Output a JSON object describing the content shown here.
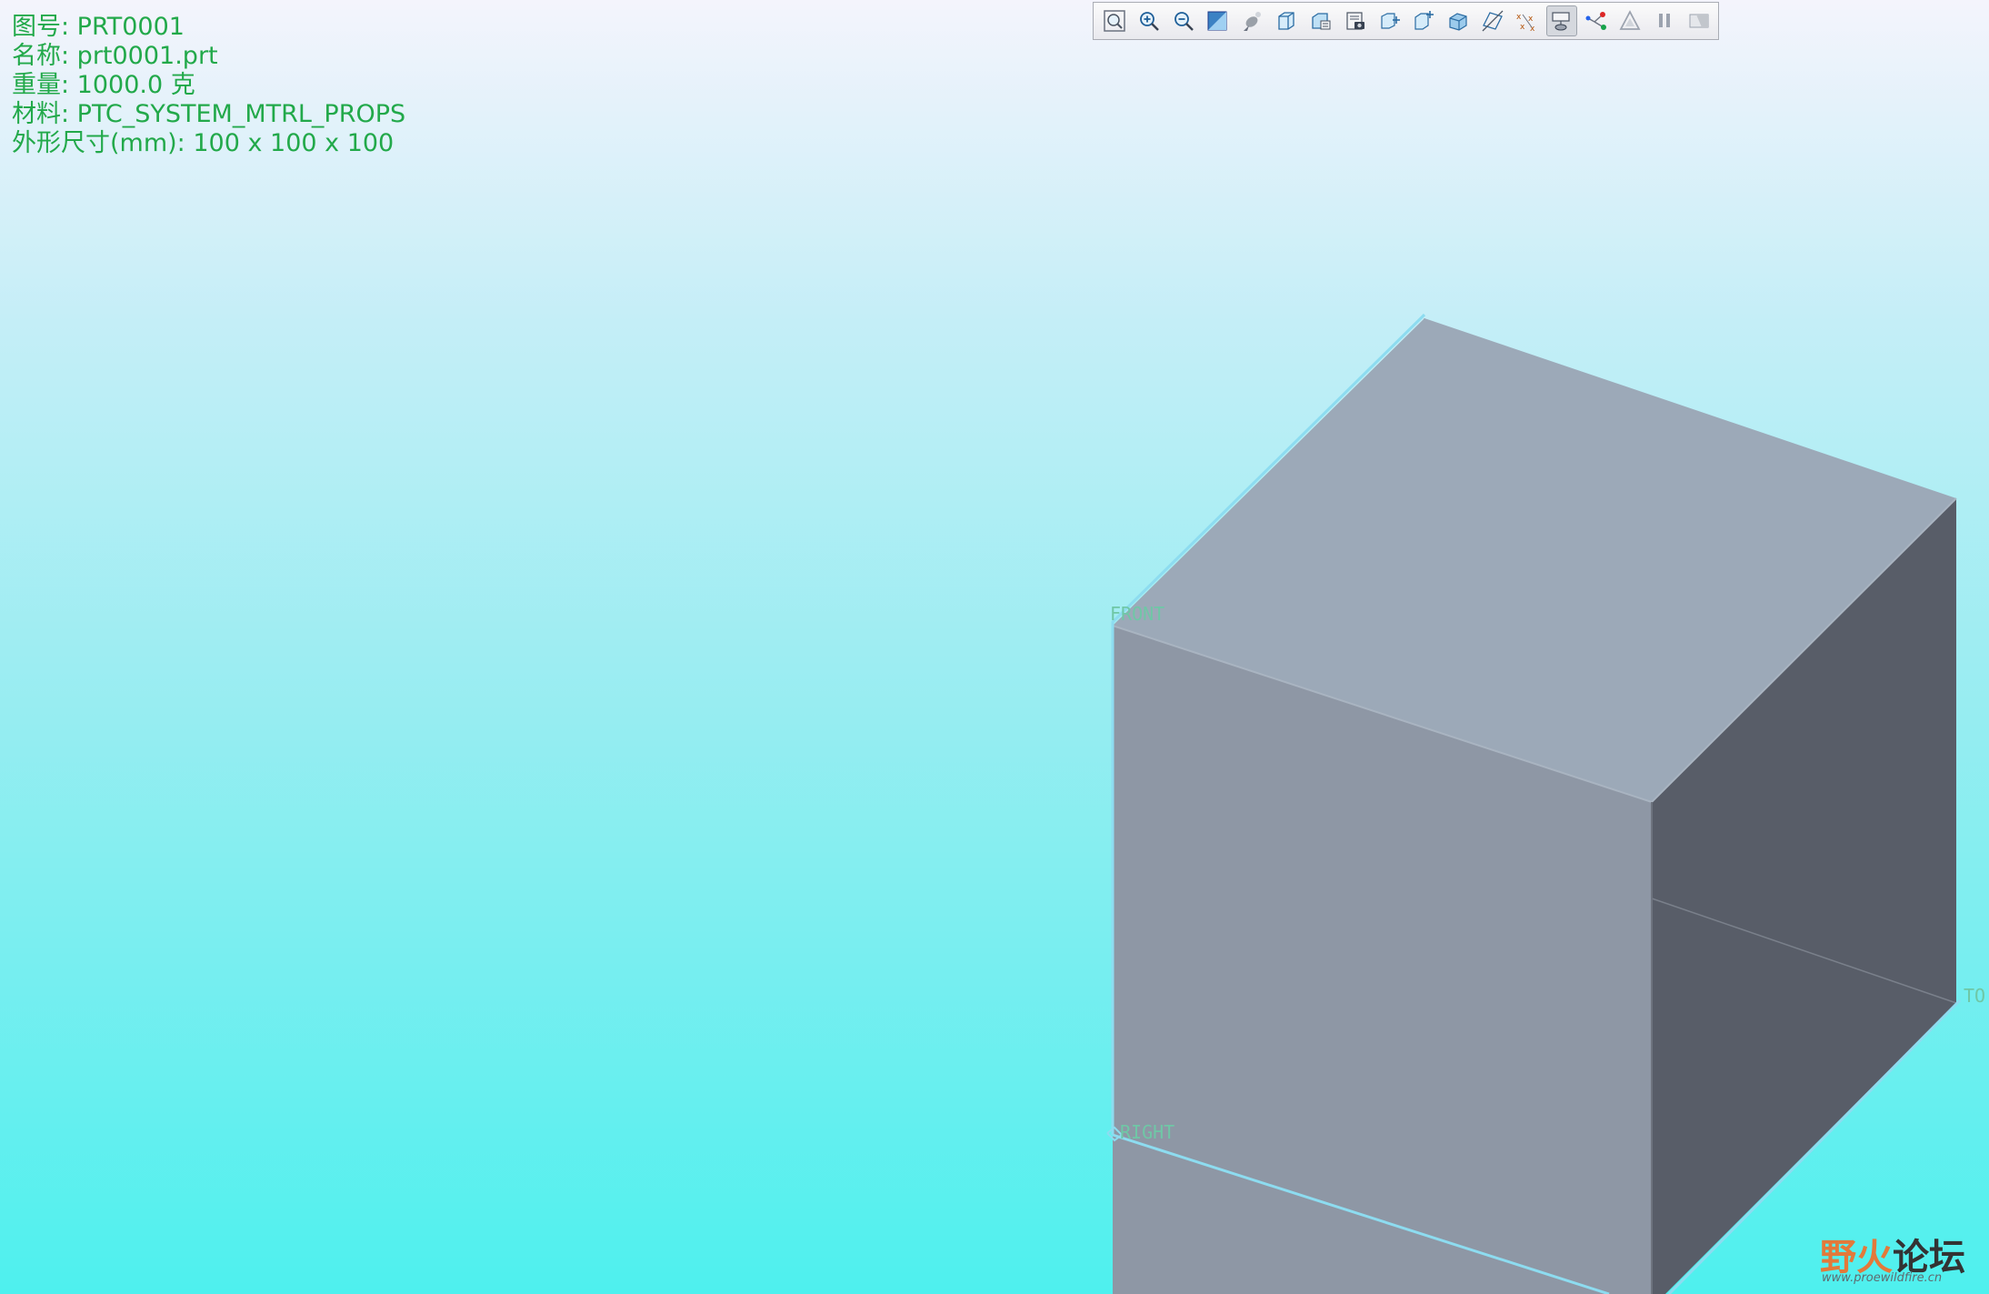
{
  "info": {
    "rows": [
      "图号: PRT0001",
      "名称: prt0001.prt",
      "重量: 1000.0 克",
      "材料: PTC_SYSTEM_MTRL_PROPS",
      "外形尺寸(mm): 100 x 100 x 100"
    ]
  },
  "toolbar": {
    "buttons": [
      {
        "icon": "refit-icon",
        "active": false
      },
      {
        "icon": "zoom-in-icon",
        "active": false
      },
      {
        "icon": "zoom-out-icon",
        "active": false
      },
      {
        "icon": "repaint-icon",
        "active": false
      },
      {
        "icon": "pan-icon",
        "active": false
      },
      {
        "icon": "display-style-icon",
        "active": false
      },
      {
        "icon": "saved-views-icon",
        "active": false
      },
      {
        "icon": "view-manager-icon",
        "active": false
      },
      {
        "icon": "perspective-icon",
        "active": false
      },
      {
        "icon": "spin-center-icon",
        "active": false
      },
      {
        "icon": "named-view-icon",
        "active": false
      },
      {
        "icon": "datum-planes-icon",
        "active": false
      },
      {
        "icon": "datum-points-icon",
        "active": false
      },
      {
        "icon": "datum-display-icon",
        "active": true
      },
      {
        "icon": "coordinate-system-icon",
        "active": false
      },
      {
        "icon": "annotations-icon",
        "active": false
      },
      {
        "icon": "pause-icon",
        "active": false
      },
      {
        "icon": "regenerate-icon",
        "active": false
      }
    ]
  },
  "datum_labels": {
    "front": "FRONT",
    "right": "RIGHT",
    "top": "TO"
  },
  "colors": {
    "info_text": "#22a94a",
    "face_top": "#9ca9b8",
    "face_front": "#8e97a5",
    "face_right": "#585d68",
    "datum_edge": "#8ddcf0"
  },
  "watermark": {
    "title_a": "野火",
    "title_b": "论坛",
    "url": "www.proewildfire.cn"
  }
}
